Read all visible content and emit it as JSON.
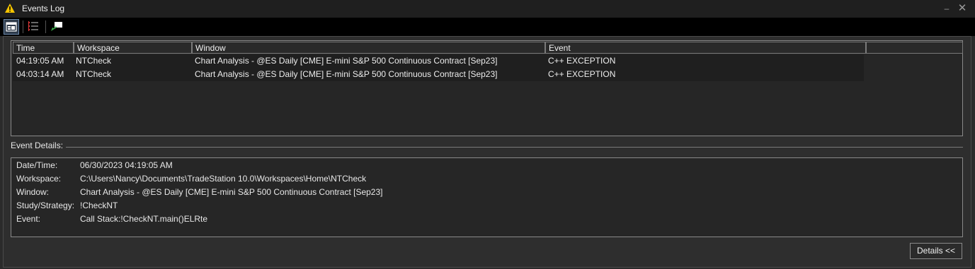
{
  "window": {
    "title": "Events Log",
    "minimize_glyph": "–",
    "close_glyph": "✕"
  },
  "toolbar": {
    "buttons": [
      {
        "icon": "layout-panel-icon",
        "active": true
      },
      {
        "icon": "event-list-icon",
        "active": false
      },
      {
        "icon": "send-message-icon",
        "active": false
      }
    ]
  },
  "grid": {
    "columns": [
      "Time",
      "Workspace",
      "Window",
      "Event",
      ""
    ],
    "rows": [
      {
        "time": "04:19:05 AM",
        "workspace": "NTCheck",
        "window": "Chart Analysis - @ES Daily [CME] E-mini S&P 500 Continuous Contract [Sep23]",
        "event": "C++ EXCEPTION"
      },
      {
        "time": "04:03:14 AM",
        "workspace": "NTCheck",
        "window": "Chart Analysis - @ES Daily [CME] E-mini S&P 500 Continuous Contract [Sep23]",
        "event": "C++ EXCEPTION"
      }
    ]
  },
  "details": {
    "section_label": "Event Details:",
    "fields": [
      {
        "key": "Date/Time:",
        "value": "06/30/2023 04:19:05 AM"
      },
      {
        "key": "Workspace:",
        "value": "C:\\Users\\Nancy\\Documents\\TradeStation 10.0\\Workspaces\\Home\\NTCheck"
      },
      {
        "key": "Window:",
        "value": "Chart Analysis - @ES Daily [CME] E-mini S&P 500 Continuous Contract [Sep23]"
      },
      {
        "key": "Study/Strategy:",
        "value": "!CheckNT"
      },
      {
        "key": "Event:",
        "value": "Call Stack:!CheckNT.main()ELRte"
      }
    ],
    "toggle_button": "Details <<"
  },
  "colors": {
    "background": "#2b2b2b",
    "toolbar": "#000000",
    "warning": "#f5c400"
  }
}
